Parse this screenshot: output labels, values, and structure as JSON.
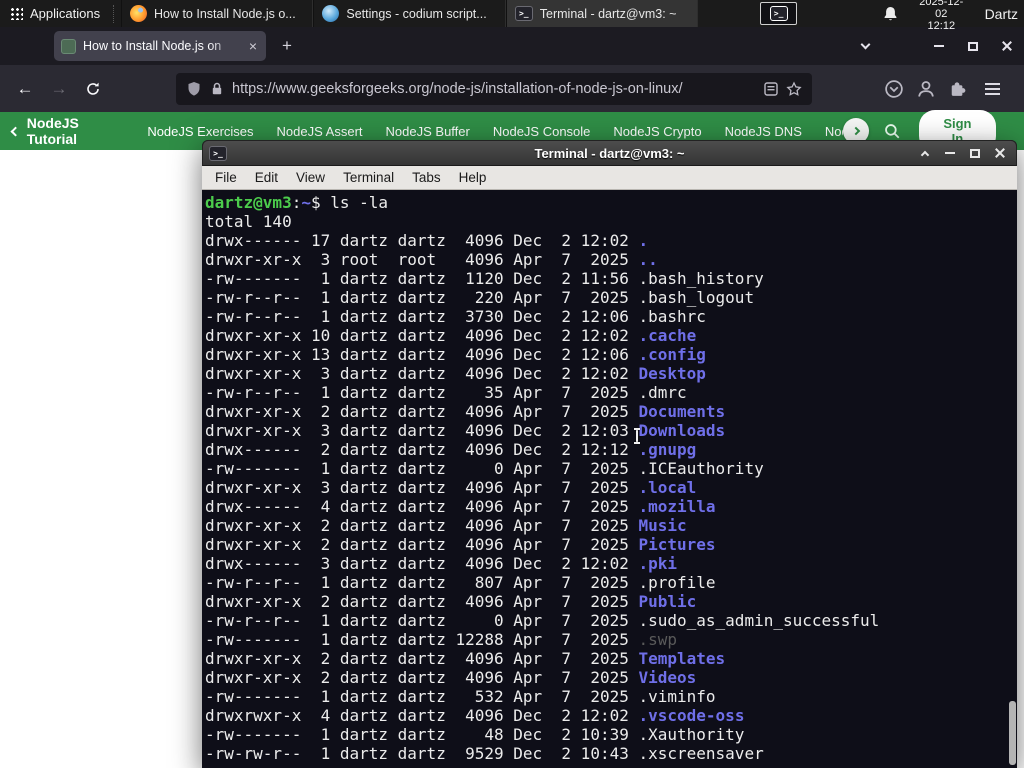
{
  "colors": {
    "accent_green": "#2f8d46",
    "terminal_bg": "#0e0e18",
    "dir_blue": "#6f6fe8",
    "prompt_green": "#4ccc4c"
  },
  "icons": {
    "plus": "+",
    "close_glyph": "×",
    "back_arrow": "←",
    "forward_arrow": "→",
    "terminal_glyph": ">_"
  },
  "panel": {
    "applications_label": "Applications",
    "tasks": [
      {
        "title": "How to Install Node.js o..."
      },
      {
        "title": "Settings - codium script..."
      },
      {
        "title": "Terminal - dartz@vm3: ~"
      }
    ],
    "clock_date": "2025-12-02",
    "clock_time": "12:12",
    "user_label": "Dartz"
  },
  "browser": {
    "tab_title": "How to Install Node.js on",
    "url": "https://www.geeksforgeeks.org/node-js/installation-of-node-js-on-linux/"
  },
  "site_nav": {
    "back_label": "NodeJS Tutorial",
    "links": [
      "NodeJS Exercises",
      "NodeJS Assert",
      "NodeJS Buffer",
      "NodeJS Console",
      "NodeJS Crypto",
      "NodeJS DNS",
      "Node"
    ],
    "signin_label": "Sign In"
  },
  "terminal": {
    "title": "Terminal - dartz@vm3: ~",
    "menu": [
      "File",
      "Edit",
      "View",
      "Terminal",
      "Tabs",
      "Help"
    ],
    "lines": [
      [
        {
          "t": "dartz@vm3",
          "c": "green"
        },
        {
          "t": ":",
          "c": ""
        },
        {
          "t": "~",
          "c": "blue"
        },
        {
          "t": "$ ls -la",
          "c": ""
        }
      ],
      [
        {
          "t": "total 140",
          "c": ""
        }
      ],
      [
        {
          "t": "drwx------ 17 dartz dartz  4096 Dec  2 12:02 ",
          "c": ""
        },
        {
          "t": ".",
          "c": "blue"
        }
      ],
      [
        {
          "t": "drwxr-xr-x  3 root  root   4096 Apr  7  2025 ",
          "c": ""
        },
        {
          "t": "..",
          "c": "blue"
        }
      ],
      [
        {
          "t": "-rw-------  1 dartz dartz  1120 Dec  2 11:56 .bash_history",
          "c": ""
        }
      ],
      [
        {
          "t": "-rw-r--r--  1 dartz dartz   220 Apr  7  2025 .bash_logout",
          "c": ""
        }
      ],
      [
        {
          "t": "-rw-r--r--  1 dartz dartz  3730 Dec  2 12:06 .bashrc",
          "c": ""
        }
      ],
      [
        {
          "t": "drwxr-xr-x 10 dartz dartz  4096 Dec  2 12:02 ",
          "c": ""
        },
        {
          "t": ".cache",
          "c": "blue"
        }
      ],
      [
        {
          "t": "drwxr-xr-x 13 dartz dartz  4096 Dec  2 12:06 ",
          "c": ""
        },
        {
          "t": ".config",
          "c": "blue"
        }
      ],
      [
        {
          "t": "drwxr-xr-x  3 dartz dartz  4096 Dec  2 12:02 ",
          "c": ""
        },
        {
          "t": "Desktop",
          "c": "blue"
        }
      ],
      [
        {
          "t": "-rw-r--r--  1 dartz dartz    35 Apr  7  2025 .dmrc",
          "c": ""
        }
      ],
      [
        {
          "t": "drwxr-xr-x  2 dartz dartz  4096 Apr  7  2025 ",
          "c": ""
        },
        {
          "t": "Documents",
          "c": "blue"
        }
      ],
      [
        {
          "t": "drwxr-xr-x  3 dartz dartz  4096 Dec  2 12:03 ",
          "c": ""
        },
        {
          "t": "Downloads",
          "c": "blue"
        }
      ],
      [
        {
          "t": "drwx------  2 dartz dartz  4096 Dec  2 12:12 ",
          "c": ""
        },
        {
          "t": ".gnupg",
          "c": "blue"
        }
      ],
      [
        {
          "t": "-rw-------  1 dartz dartz     0 Apr  7  2025 .ICEauthority",
          "c": ""
        }
      ],
      [
        {
          "t": "drwxr-xr-x  3 dartz dartz  4096 Apr  7  2025 ",
          "c": ""
        },
        {
          "t": ".local",
          "c": "blue"
        }
      ],
      [
        {
          "t": "drwx------  4 dartz dartz  4096 Apr  7  2025 ",
          "c": ""
        },
        {
          "t": ".mozilla",
          "c": "blue"
        }
      ],
      [
        {
          "t": "drwxr-xr-x  2 dartz dartz  4096 Apr  7  2025 ",
          "c": ""
        },
        {
          "t": "Music",
          "c": "blue"
        }
      ],
      [
        {
          "t": "drwxr-xr-x  2 dartz dartz  4096 Apr  7  2025 ",
          "c": ""
        },
        {
          "t": "Pictures",
          "c": "blue"
        }
      ],
      [
        {
          "t": "drwx------  3 dartz dartz  4096 Dec  2 12:02 ",
          "c": ""
        },
        {
          "t": ".pki",
          "c": "blue"
        }
      ],
      [
        {
          "t": "-rw-r--r--  1 dartz dartz   807 Apr  7  2025 .profile",
          "c": ""
        }
      ],
      [
        {
          "t": "drwxr-xr-x  2 dartz dartz  4096 Apr  7  2025 ",
          "c": ""
        },
        {
          "t": "Public",
          "c": "blue"
        }
      ],
      [
        {
          "t": "-rw-r--r--  1 dartz dartz     0 Apr  7  2025 .sudo_as_admin_successful",
          "c": ""
        }
      ],
      [
        {
          "t": "-rw-------  1 dartz dartz 12288 Apr  7  2025 ",
          "c": ""
        },
        {
          "t": ".swp",
          "c": "dim"
        }
      ],
      [
        {
          "t": "drwxr-xr-x  2 dartz dartz  4096 Apr  7  2025 ",
          "c": ""
        },
        {
          "t": "Templates",
          "c": "blue"
        }
      ],
      [
        {
          "t": "drwxr-xr-x  2 dartz dartz  4096 Apr  7  2025 ",
          "c": ""
        },
        {
          "t": "Videos",
          "c": "blue"
        }
      ],
      [
        {
          "t": "-rw-------  1 dartz dartz   532 Apr  7  2025 .viminfo",
          "c": ""
        }
      ],
      [
        {
          "t": "drwxrwxr-x  4 dartz dartz  4096 Dec  2 12:02 ",
          "c": ""
        },
        {
          "t": ".vscode-oss",
          "c": "blue"
        }
      ],
      [
        {
          "t": "-rw-------  1 dartz dartz    48 Dec  2 10:39 .Xauthority",
          "c": ""
        }
      ],
      [
        {
          "t": "-rw-rw-r--  1 dartz dartz  9529 Dec  2 10:43 .xscreensaver",
          "c": ""
        }
      ]
    ]
  }
}
